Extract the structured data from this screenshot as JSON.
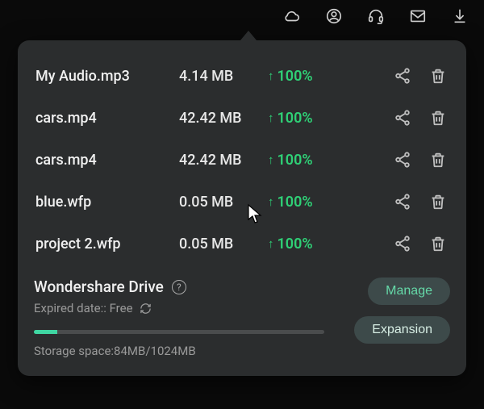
{
  "topbar": {
    "icons": [
      "cloud-icon",
      "profile-icon",
      "headset-icon",
      "mail-icon",
      "download-icon"
    ]
  },
  "files": [
    {
      "name": "My Audio.mp3",
      "size": "4.14 MB",
      "status": "100%"
    },
    {
      "name": "cars.mp4",
      "size": "42.42 MB",
      "status": "100%"
    },
    {
      "name": "cars.mp4",
      "size": "42.42 MB",
      "status": "100%"
    },
    {
      "name": "blue.wfp",
      "size": "0.05 MB",
      "status": "100%"
    },
    {
      "name": "project 2.wfp",
      "size": "0.05 MB",
      "status": "100%"
    }
  ],
  "drive": {
    "title": "Wondershare Drive",
    "expired_label": "Expired date:: Free",
    "storage_label": "Storage space:84MB/1024MB",
    "manage_label": "Manage",
    "expansion_label": "Expansion",
    "progress_pct": 8
  },
  "colors": {
    "accent_green": "#2fd076",
    "panel_bg": "#2b2d2e"
  }
}
